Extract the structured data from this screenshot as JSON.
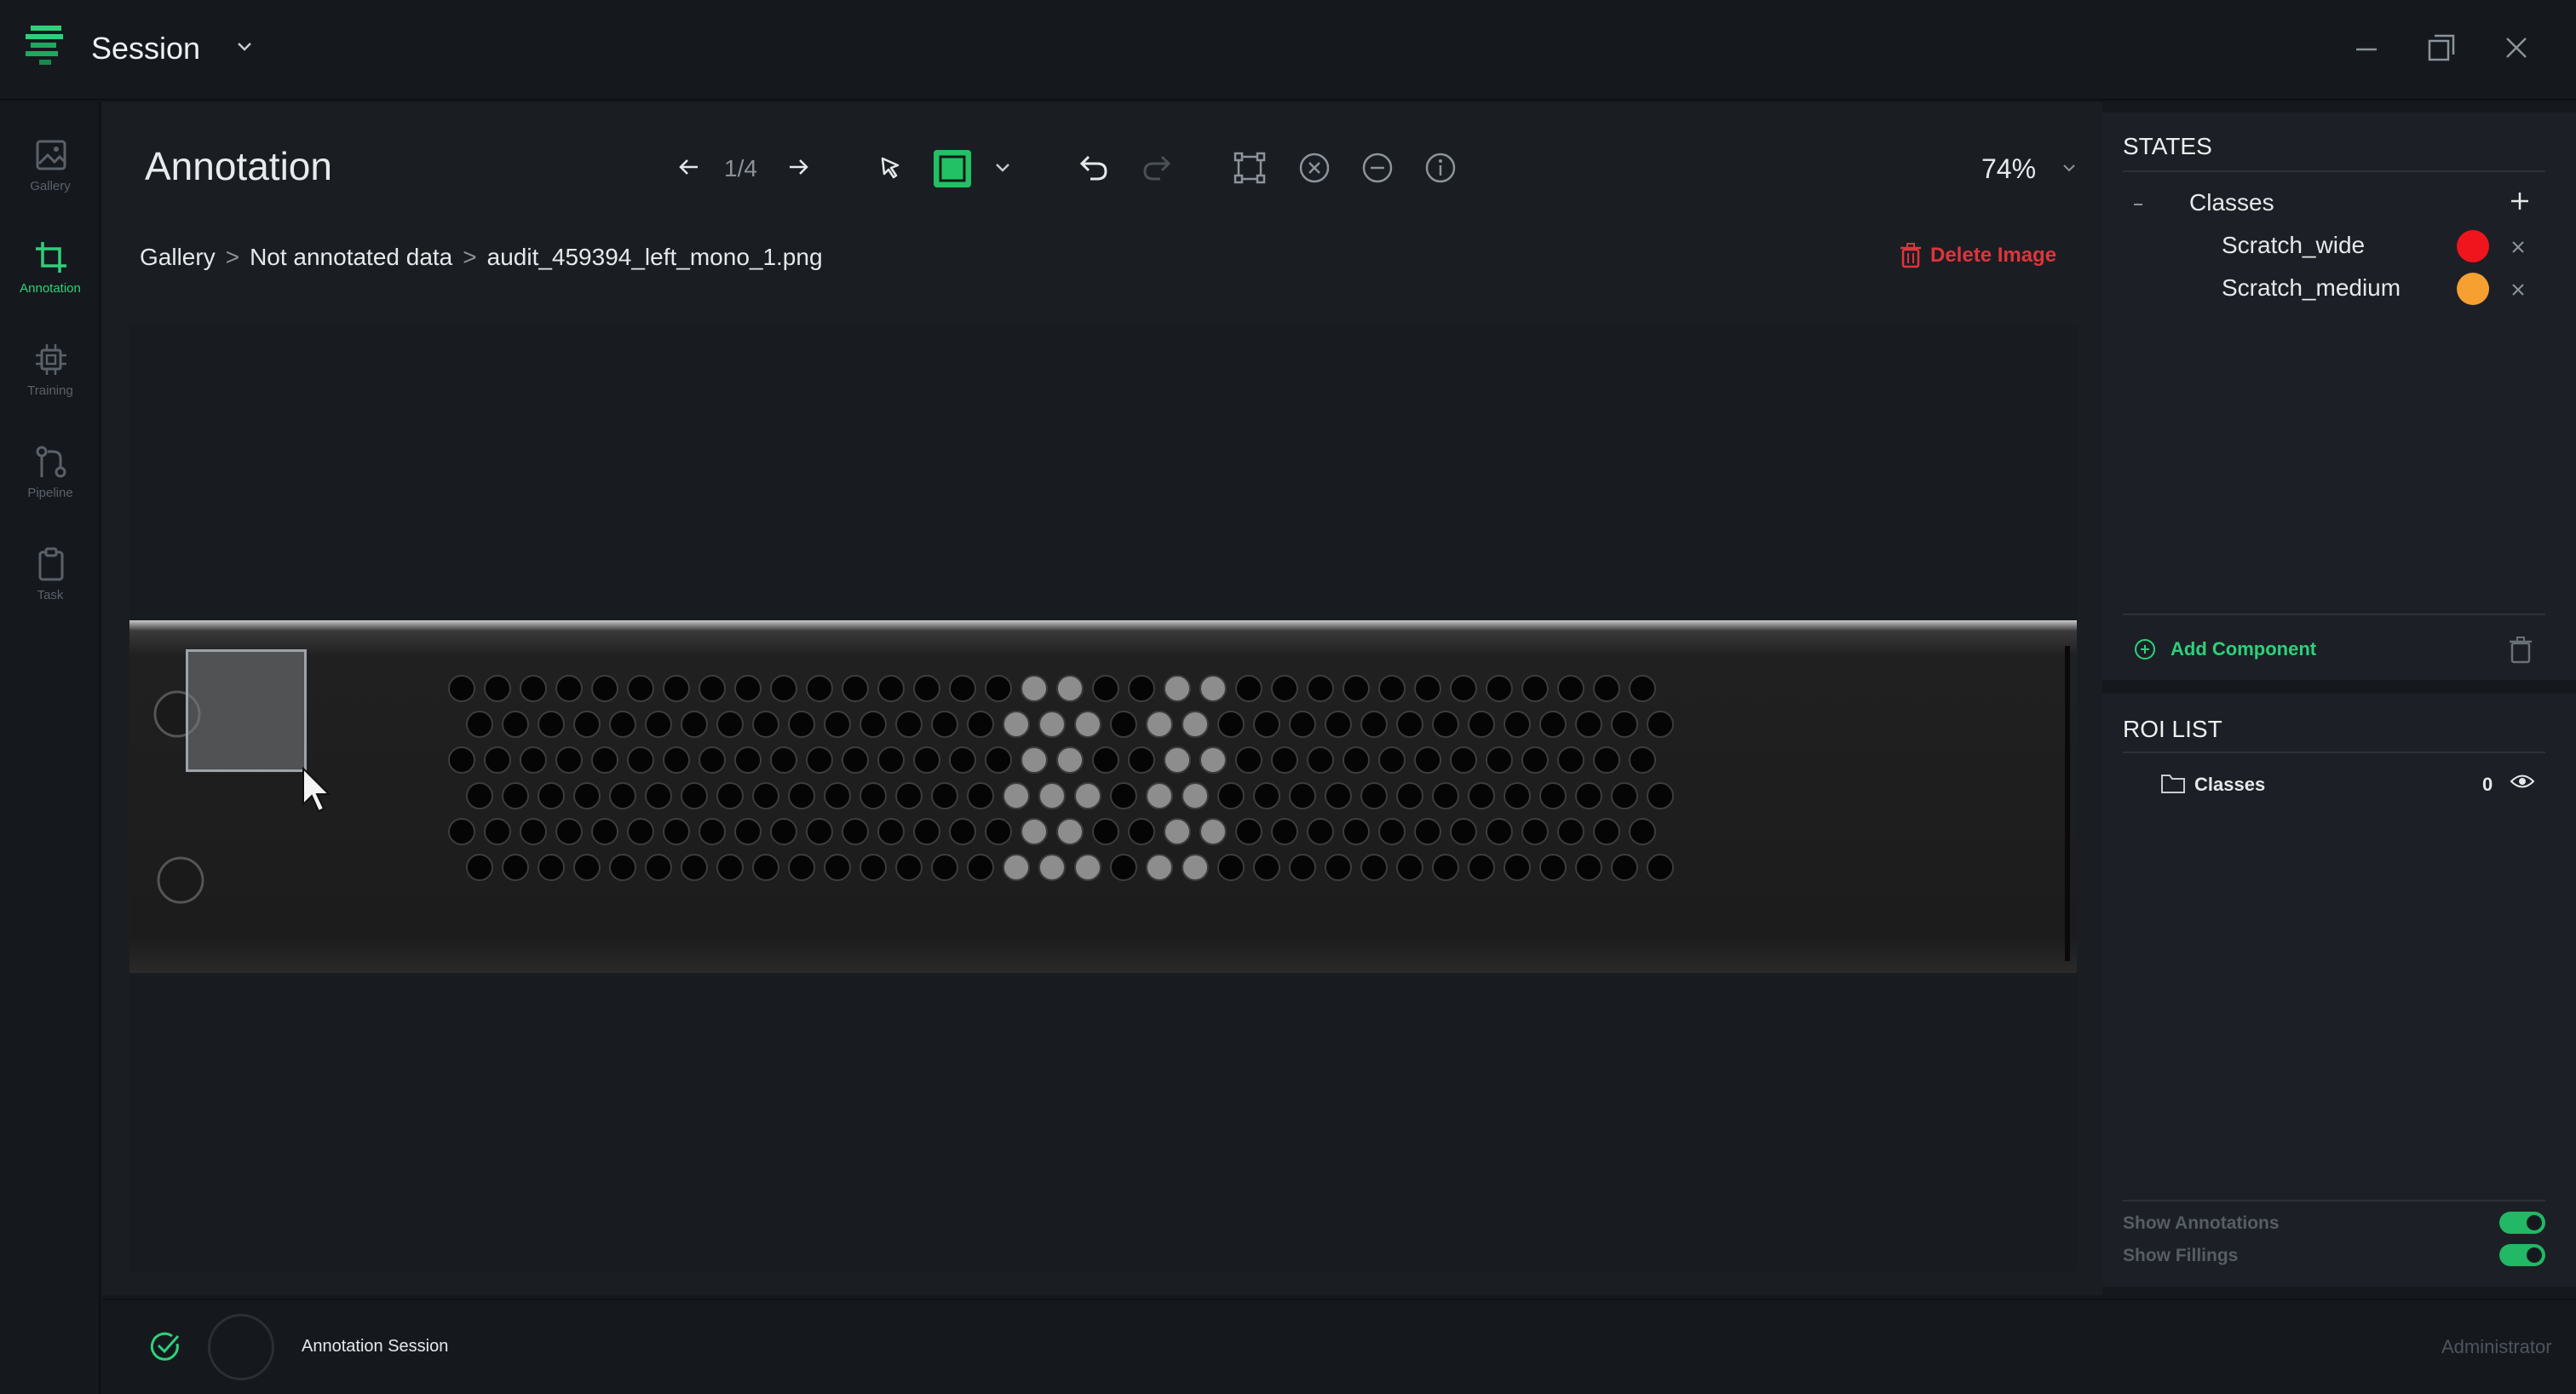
{
  "window": {
    "title": "Session",
    "title_icon": "chevron-down-icon",
    "controls": [
      "minimize-icon",
      "restore-icon",
      "close-icon"
    ]
  },
  "rail": {
    "items": [
      {
        "label": "Gallery",
        "icon": "gallery-icon",
        "active": false
      },
      {
        "label": "Annotation",
        "icon": "crop-icon",
        "active": true
      },
      {
        "label": "Training",
        "icon": "chip-icon",
        "active": false
      },
      {
        "label": "Pipeline",
        "icon": "pipeline-icon",
        "active": false
      },
      {
        "label": "Task",
        "icon": "clipboard-icon",
        "active": false
      }
    ]
  },
  "header": {
    "title": "Annotation",
    "page_counter": "1/4",
    "zoom": "74%",
    "tools": [
      "arrow-left-icon",
      "arrow-right-icon",
      "select-pointer-icon",
      "rectangle-tool-icon",
      "chevron-down-icon",
      "undo-icon",
      "redo-icon",
      "bounding-box-icon",
      "clear-circle-icon",
      "minus-circle-icon",
      "info-icon"
    ]
  },
  "breadcrumb": {
    "items": [
      "Gallery",
      "Not annotated data",
      "audit_459394_left_mono_1.png"
    ],
    "separator": ">"
  },
  "delete_image": "Delete Image",
  "states": {
    "title": "STATES",
    "group_label": "Classes",
    "classes": [
      {
        "name": "Scratch_wide",
        "color": "#f0141c"
      },
      {
        "name": "Scratch_medium",
        "color": "#f5a030"
      }
    ],
    "add_component": "Add Component"
  },
  "roi_list": {
    "title": "ROI LIST",
    "group_label": "Classes",
    "count": "0"
  },
  "toggles": {
    "show_annotations": "Show Annotations",
    "show_fillings": "Show Fillings"
  },
  "status": {
    "session_label": "Annotation Session",
    "user": "Administrator"
  },
  "colors": {
    "accent": "#2fd07a",
    "danger": "#e0343c",
    "background": "#15191e"
  }
}
